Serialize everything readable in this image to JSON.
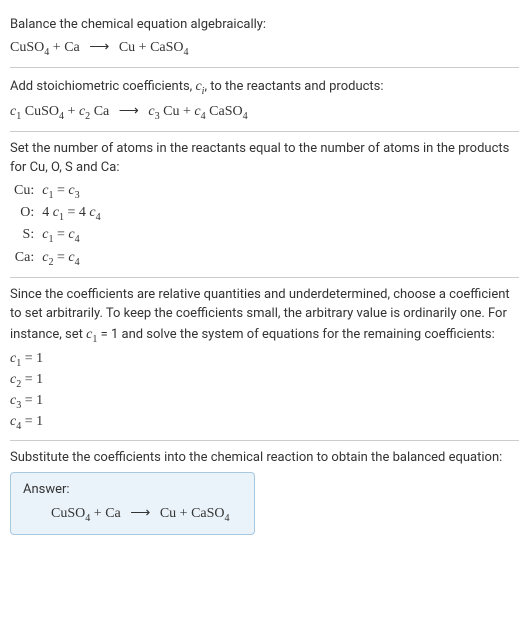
{
  "header": {
    "prompt": "Balance the chemical equation algebraically:",
    "species": {
      "r1": "CuSO",
      "r1sub": "4",
      "r2": "Ca",
      "p1": "Cu",
      "p2": "CaSO",
      "p2sub": "4"
    },
    "arrow": "⟶"
  },
  "step_coeffs": {
    "text": "Add stoichiometric coefficients, ",
    "ci": "c",
    "ci_sub": "i",
    "text2": ", to the reactants and products:",
    "c": [
      "1",
      "2",
      "3",
      "4"
    ]
  },
  "step_atoms": {
    "intro": "Set the number of atoms in the reactants equal to the number of atoms in the products for Cu, O, S and Ca:",
    "rows": [
      {
        "elem": "Cu:",
        "lhs_coef": "",
        "lhs_c": "c",
        "lhs_i": "1",
        "eq": " = ",
        "rhs_coef": "",
        "rhs_c": "c",
        "rhs_i": "3"
      },
      {
        "elem": "O:",
        "lhs_coef": "4 ",
        "lhs_c": "c",
        "lhs_i": "1",
        "eq": " = ",
        "rhs_coef": "4 ",
        "rhs_c": "c",
        "rhs_i": "4"
      },
      {
        "elem": "S:",
        "lhs_coef": "",
        "lhs_c": "c",
        "lhs_i": "1",
        "eq": " = ",
        "rhs_coef": "",
        "rhs_c": "c",
        "rhs_i": "4"
      },
      {
        "elem": "Ca:",
        "lhs_coef": "",
        "lhs_c": "c",
        "lhs_i": "2",
        "eq": " = ",
        "rhs_coef": "",
        "rhs_c": "c",
        "rhs_i": "4"
      }
    ]
  },
  "step_solve": {
    "text_a": "Since the coefficients are relative quantities and underdetermined, choose a coefficient to set arbitrarily. To keep the coefficients small, the arbitrary value is ordinarily one. For instance, set ",
    "c": "c",
    "ci": "1",
    "text_b": " = 1 and solve the system of equations for the remaining coefficients:",
    "solutions": [
      {
        "c": "c",
        "i": "1",
        "val": " = 1"
      },
      {
        "c": "c",
        "i": "2",
        "val": " = 1"
      },
      {
        "c": "c",
        "i": "3",
        "val": " = 1"
      },
      {
        "c": "c",
        "i": "4",
        "val": " = 1"
      }
    ]
  },
  "step_sub": {
    "text": "Substitute the coefficients into the chemical reaction to obtain the balanced equation:"
  },
  "answer": {
    "label": "Answer:"
  }
}
